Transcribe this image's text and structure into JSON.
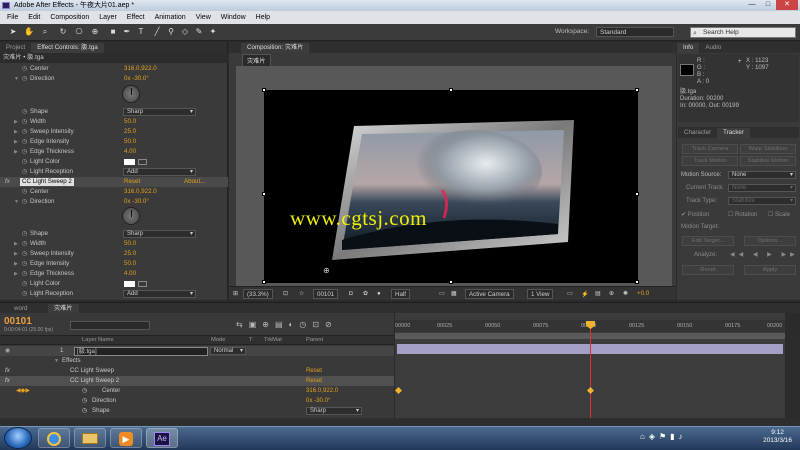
{
  "window": {
    "title": "Adobe After Effects - 午夜大片01.aep *",
    "controls": [
      "—",
      "□",
      "✕"
    ]
  },
  "menu": [
    "File",
    "Edit",
    "Composition",
    "Layer",
    "Effect",
    "Animation",
    "View",
    "Window",
    "Help"
  ],
  "toolbar": {
    "workspace_label": "Workspace:",
    "workspace_value": "Standard",
    "search_placeholder": "Search Help"
  },
  "left": {
    "tabs": [
      "Project",
      "Effect Controls: 䏜.tga"
    ],
    "breadcrumb": "灾难片 • 䏜.tga",
    "rows1": [
      {
        "label": "Center",
        "value": "316.0,922.0"
      },
      {
        "label": "Direction",
        "value": "0x -30.0°"
      },
      {
        "label": "Shape",
        "value": "Sharp"
      },
      {
        "label": "Width",
        "value": "50.0"
      },
      {
        "label": "Sweep Intensity",
        "value": "25.0"
      },
      {
        "label": "Edge Intensity",
        "value": "50.0"
      },
      {
        "label": "Edge Thickness",
        "value": "4.00"
      },
      {
        "label": "Light Color",
        "value": ""
      },
      {
        "label": "Light Reception",
        "value": "Add"
      }
    ],
    "effect2": {
      "fx": "fx",
      "name": "CC Light Sweep 2",
      "reset": "Reset",
      "about": "About..."
    },
    "rows2": [
      {
        "label": "Center",
        "value": "316.0,922.0"
      },
      {
        "label": "Direction",
        "value": "0x -30.0°"
      },
      {
        "label": "Shape",
        "value": "Sharp"
      },
      {
        "label": "Width",
        "value": "50.0"
      },
      {
        "label": "Sweep Intensity",
        "value": "25.0"
      },
      {
        "label": "Edge Intensity",
        "value": "50.0"
      },
      {
        "label": "Edge Thickness",
        "value": "4.00"
      },
      {
        "label": "Light Color",
        "value": ""
      },
      {
        "label": "Light Reception",
        "value": "Add"
      }
    ]
  },
  "comp": {
    "tab": "Composition: 灾难片",
    "sub_tab": "灾难片",
    "watermark": "www.cgtsj.com",
    "footer": {
      "zoom": "(33.3%)",
      "timecode": "00101",
      "resolution": "Half",
      "camera": "Active Camera",
      "views": "1 View",
      "exposure": "+0.0"
    }
  },
  "right": {
    "tabs": [
      "Info",
      "Audio"
    ],
    "rgba": [
      "R :",
      "G :",
      "B :",
      "A : 0"
    ],
    "coords": [
      "X : 1123",
      "Y : 1097"
    ],
    "layer": "䏜.tga",
    "duration": "Duration: 00200",
    "inout": "In: 00000, Out: 00199",
    "tabs2": [
      "Character",
      "Tracker"
    ],
    "track_btns": [
      "Track Camera",
      "Warp Stabilizer",
      "Track Motion",
      "Stabilize Motion"
    ],
    "motion_source_label": "Motion Source:",
    "motion_source_value": "None",
    "current_track_label": "Current Track:",
    "current_track_value": "None",
    "track_type_label": "Track Type:",
    "track_type_value": "Stabilize",
    "checks": [
      "Position",
      "Rotation",
      "Scale"
    ],
    "motion_target": "Motion Target:",
    "edit_target": "Edit Target...",
    "options": "Options...",
    "analyze": "Analyze:",
    "reset": "Reset",
    "apply": "Apply"
  },
  "timeline": {
    "tabs": [
      "word",
      "灾难片"
    ],
    "timecode": "00101",
    "timecode_sub": "0:00:04:01 (25.00 fps)",
    "search_placeholder": "",
    "headers": {
      "name": "Layer Name",
      "mode": "Mode",
      "t": "T",
      "trkmat": "TrkMat",
      "parent": "Parent"
    },
    "ruler": [
      "00000",
      "00025",
      "00050",
      "00075",
      "00100",
      "00125",
      "00150",
      "00175",
      "00200"
    ],
    "layers": [
      {
        "num": "1",
        "name": "[䏜.tga]",
        "mode": "Normal"
      },
      {
        "name": "Effects"
      },
      {
        "name": "CC Light Sweep",
        "value": "Reset"
      },
      {
        "name": "CC Light Sweep 2",
        "value": "Reset"
      },
      {
        "name": "Center",
        "value": "316.0,922.0"
      },
      {
        "name": "Direction",
        "value": "0x -30.0°"
      },
      {
        "name": "Shape",
        "value": "Sharp"
      }
    ]
  },
  "taskbar": {
    "time": "9:12",
    "date": "2013/3/16",
    "ae_label": "Ae"
  }
}
